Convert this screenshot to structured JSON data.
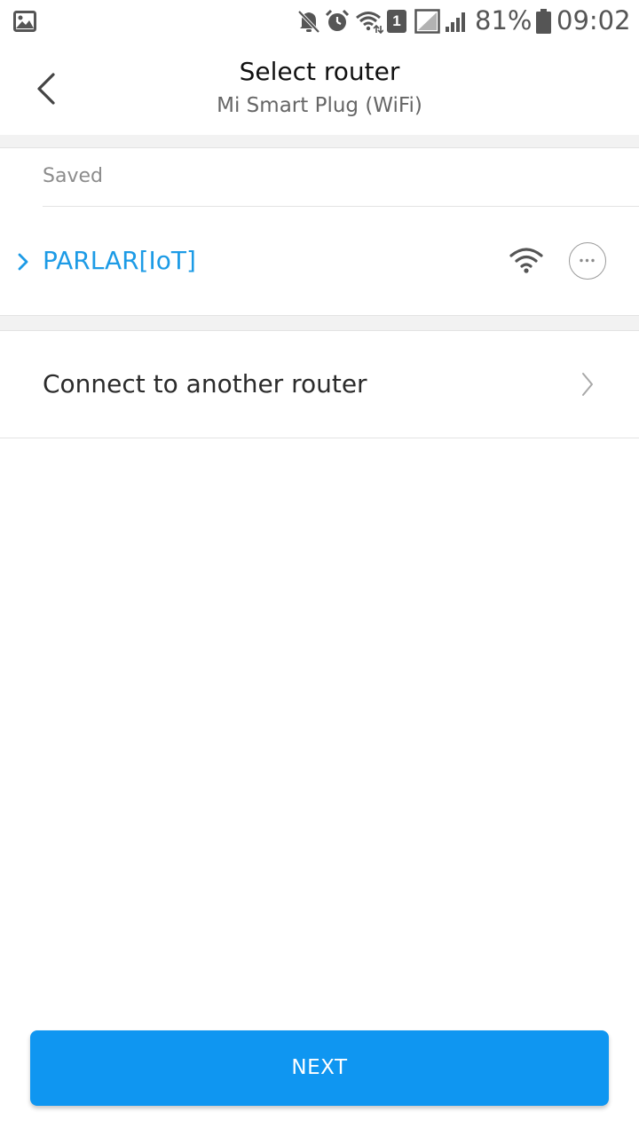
{
  "status_bar": {
    "battery": "81%",
    "time": "09:02",
    "sim_slot": "1",
    "icons": [
      "gallery-icon",
      "mute-icon",
      "alarm-icon",
      "wifi-icon",
      "sim-icon",
      "no-signal-icon",
      "signal-icon",
      "battery-icon"
    ]
  },
  "header": {
    "title": "Select router",
    "subtitle": "Mi Smart Plug (WiFi)",
    "back_icon": "back-arrow-icon"
  },
  "saved_section": {
    "label": "Saved",
    "routers": [
      {
        "name": "PARLAR[IoT]",
        "selected": true,
        "icons": [
          "selected-chevron-icon",
          "wifi-signal-icon",
          "more-options-icon"
        ]
      }
    ]
  },
  "other": {
    "label": "Connect to another router",
    "icon": "chevron-right-icon"
  },
  "footer": {
    "next_label": "NEXT"
  },
  "colors": {
    "accent": "#1d9be6",
    "button": "#0f96f1",
    "band": "#f2f2f2"
  }
}
